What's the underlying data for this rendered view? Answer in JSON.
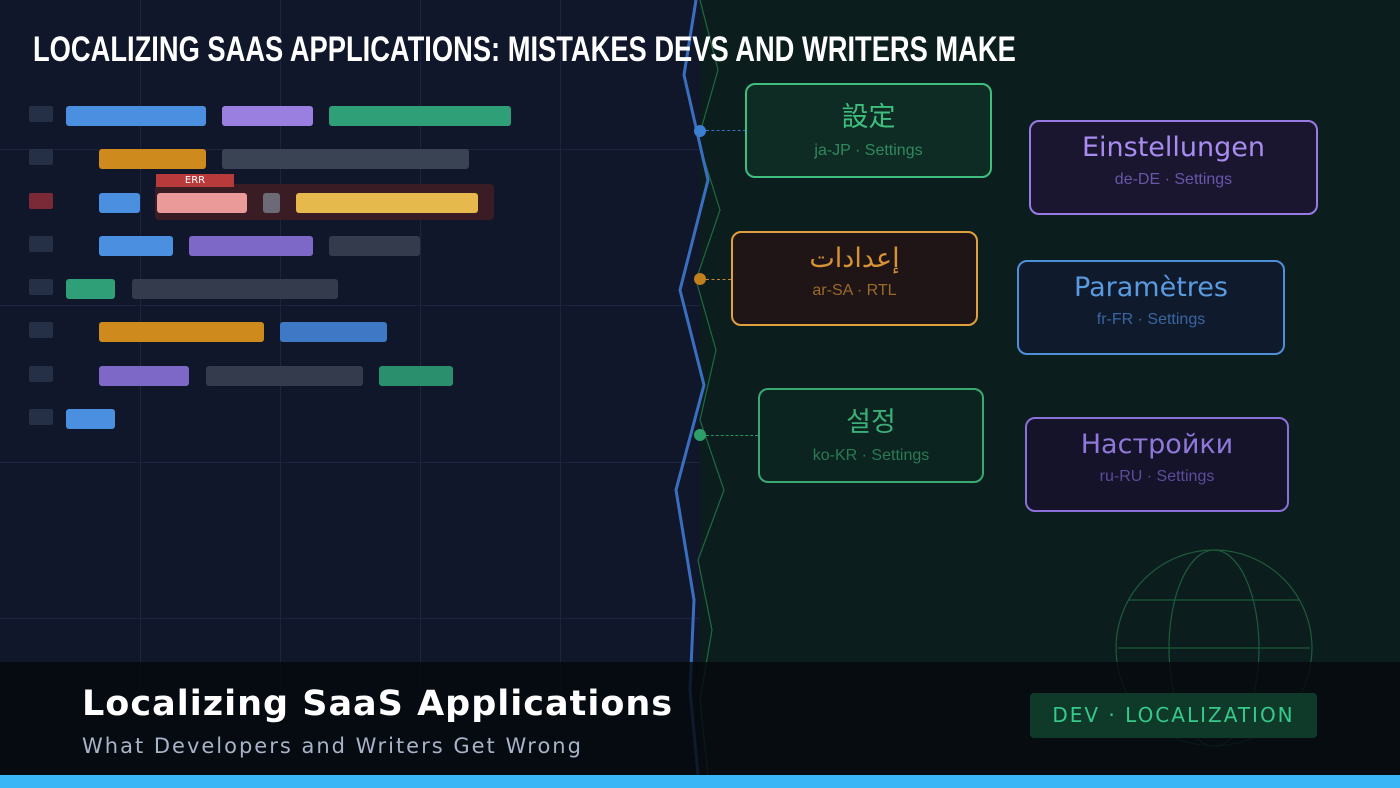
{
  "header": {
    "title": "LOCALIZING SAAS APPLICATIONS: MISTAKES DEVS AND WRITERS MAKE"
  },
  "code_panel": {
    "error_tag": "ERR"
  },
  "locales": [
    {
      "word": "設定",
      "meta": "ja-JP · Settings",
      "color": "#3fbf7f"
    },
    {
      "word": "Einstellungen",
      "meta": "de-DE · Settings",
      "color": "#9a7be6"
    },
    {
      "word": "إعدادات",
      "meta": "ar-SA · RTL",
      "color": "#e0a040"
    },
    {
      "word": "Paramètres",
      "meta": "fr-FR · Settings",
      "color": "#4f8fd8"
    },
    {
      "word": "설정",
      "meta": "ko-KR · Settings",
      "color": "#3fbf7f"
    },
    {
      "word": "Настройки",
      "meta": "ru-RU · Settings",
      "color": "#8a70d8"
    }
  ],
  "footer": {
    "title": "Localizing SaaS Applications",
    "subtitle": "What Developers and Writers Get Wrong",
    "badge": "DEV · LOCALIZATION"
  },
  "colors": {
    "accent": "#38b6f5",
    "brand_green": "#35c98a"
  },
  "icons": [
    "globe-icon"
  ]
}
